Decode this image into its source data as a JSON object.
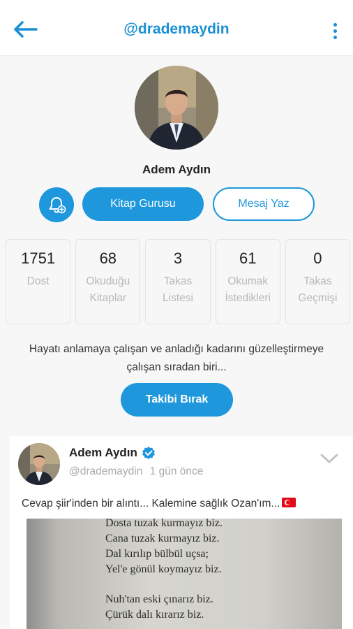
{
  "header": {
    "title": "@drademaydin"
  },
  "profile": {
    "name": "Adem Aydın",
    "primary_button": "Kitap Gurusu",
    "message_button": "Mesaj Yaz",
    "bio": "Hayatı anlamaya çalışan ve anladığı kadarını güzelleştirmeye çalışan sıradan biri...",
    "unfollow_button": "Takibi Bırak"
  },
  "stats": [
    {
      "value": "1751",
      "label": "Dost"
    },
    {
      "value": "68",
      "label": "Okuduğu Kitaplar"
    },
    {
      "value": "3",
      "label": "Takas Listesi"
    },
    {
      "value": "61",
      "label": "Okumak İstedikleri"
    },
    {
      "value": "0",
      "label": "Takas Geçmişi"
    }
  ],
  "post": {
    "author": "Adem Aydın",
    "handle": "@drademaydin",
    "time": "1 gün önce",
    "text": "Cevap şiir'inden bir alıntı... Kalemine sağlık Ozan'ım...",
    "poem_lines": [
      "Dosta tuzak kurmayız biz.",
      "Cana tuzak kurmayız biz.",
      "Dal kırılıp bülbül uçsa;",
      "Yel'e gönül koymayız biz.",
      "Nuh'tan eski çınarız biz.",
      "Çürük dalı kırarız biz."
    ]
  },
  "colors": {
    "accent": "#1e97dc",
    "title": "#1b8fd6",
    "verified": "#1e97dc",
    "muted": "#b8b8b8"
  },
  "icons": {
    "back": "arrow-left-icon",
    "menu": "more-vertical-icon",
    "bell": "bell-plus-icon",
    "verified": "verified-check-icon",
    "chevron": "chevron-down-icon"
  }
}
